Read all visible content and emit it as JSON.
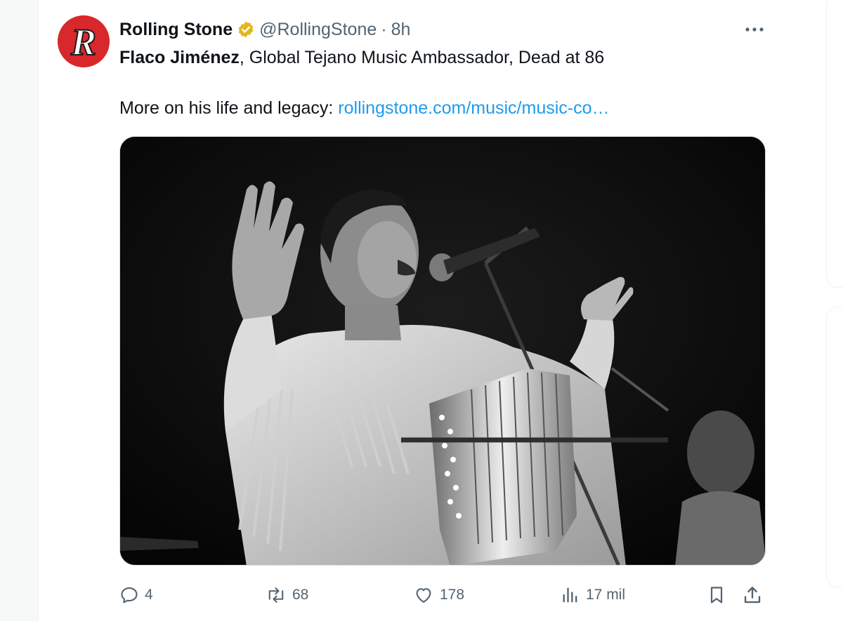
{
  "tweet": {
    "author": {
      "display_name": "Rolling Stone",
      "handle": "@RollingStone",
      "separator": "·",
      "time": "8h",
      "avatar_letter": "R",
      "verified_color": "#e2b719"
    },
    "text": {
      "bold_part": "Flaco Jiménez",
      "rest_line1": ", Global Tejano Music Ambassador, Dead at 86",
      "line2_prefix": "More on his life and legacy: ",
      "link_text": "rollingstone.com/music/music-co…"
    },
    "media": {
      "description_icon": "photo-image"
    },
    "actions": {
      "reply_count": "4",
      "repost_count": "68",
      "like_count": "178",
      "views_count": "17 mil"
    }
  },
  "colors": {
    "link": "#1d9bf0",
    "muted": "#536471",
    "brand_red": "#d8282b"
  }
}
